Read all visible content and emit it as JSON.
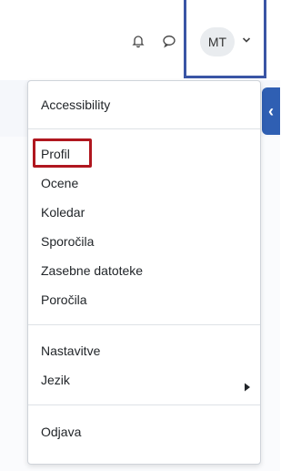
{
  "navbar": {
    "notifications_icon": "bell-icon",
    "messages_icon": "chat-bubble-icon",
    "user_initials": "MT",
    "user_menu_icon": "chevron-down-icon",
    "highlight_color": "#3a55a5"
  },
  "drawer_toggle": {
    "icon": "chevron-left-icon",
    "glyph": "‹",
    "color": "#2f5fb3"
  },
  "user_menu": {
    "accessibility": "Accessibility",
    "items": [
      "Profil",
      "Ocene",
      "Koledar",
      "Sporočila",
      "Zasebne datoteke",
      "Poročila"
    ],
    "preferences": "Nastavitve",
    "language": "Jezik",
    "language_submenu_icon": "caret-right-icon",
    "logout": "Odjava",
    "highlighted_item": "Profil",
    "highlight_color": "#b0171f"
  }
}
